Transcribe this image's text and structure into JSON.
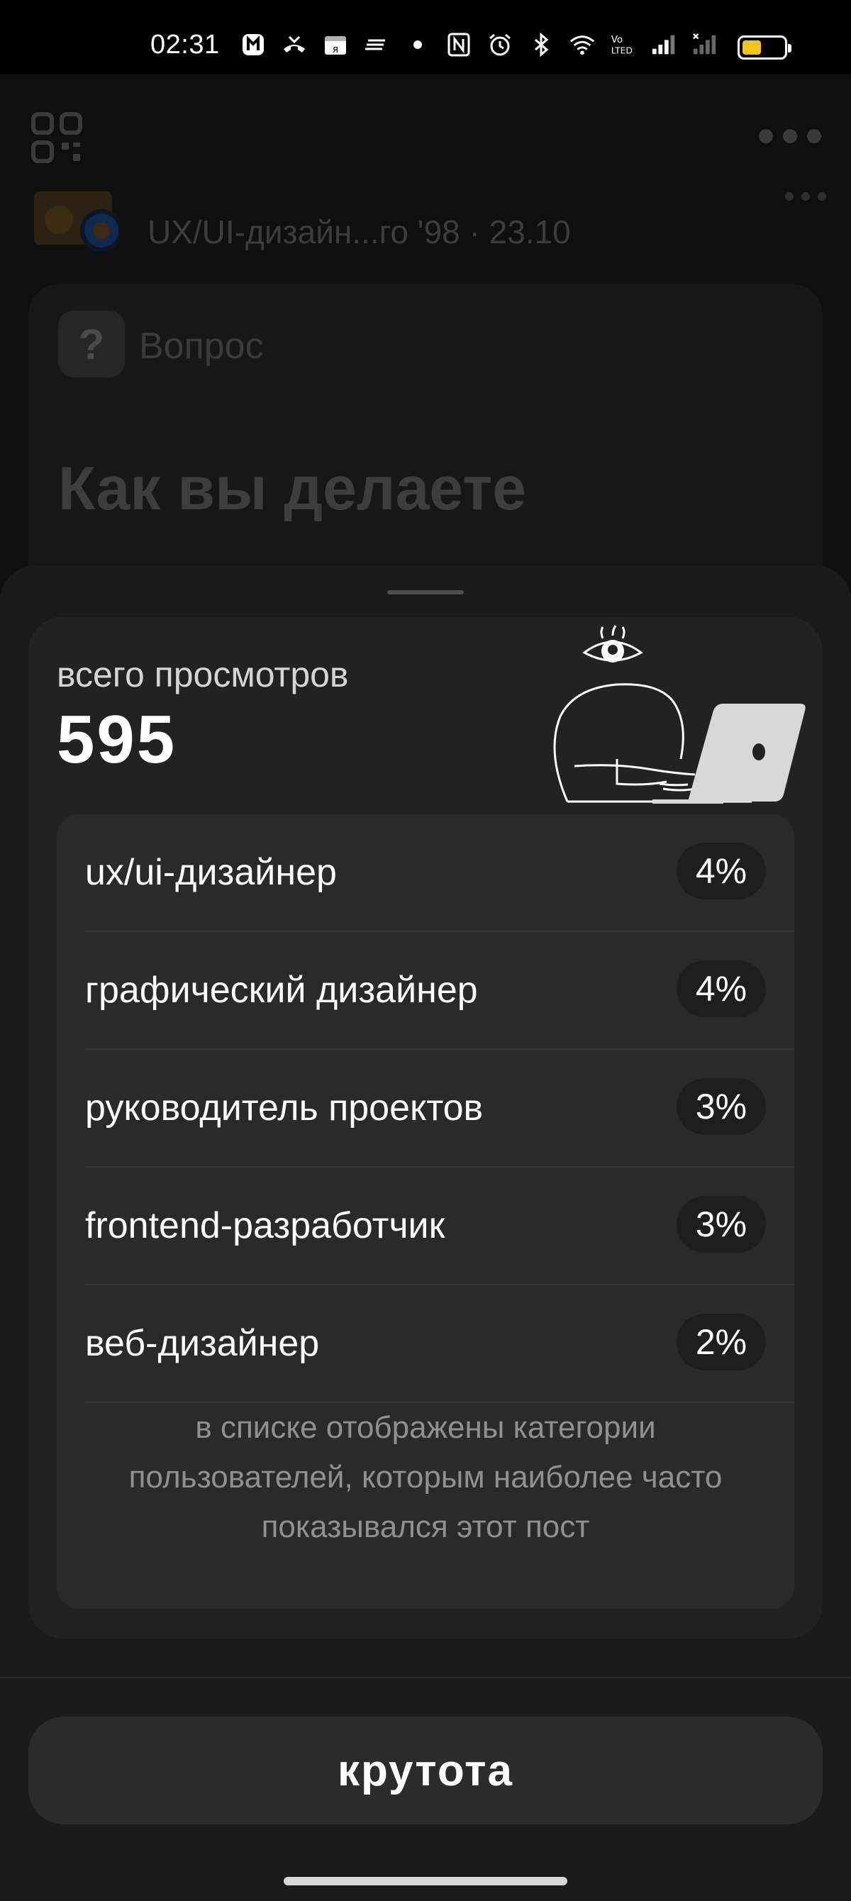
{
  "status_bar": {
    "time": "02:31",
    "icons": [
      "app-icon",
      "missed-call-icon",
      "yandex-icon",
      "notes-icon",
      "dot-icon",
      "nfc-icon",
      "alarm-icon",
      "bluetooth-icon",
      "wifi-icon",
      "volte-icon",
      "signal-icon",
      "signal-empty-icon",
      "battery-icon"
    ],
    "volte_text": "Vo\nLTED",
    "battery_level": 0.45,
    "battery_color": "#f5c41b"
  },
  "background_post": {
    "author_meta": "UX/UI-дизайн...го '98 · 23.10",
    "question_badge": "?",
    "question_label": "Вопрос",
    "title": "Как вы делаете"
  },
  "sheet": {
    "views_label": "всего просмотров",
    "views_count": "595",
    "categories": [
      {
        "label": "ux/ui-дизайнер",
        "percent": "4%"
      },
      {
        "label": "графический дизайнер",
        "percent": "4%"
      },
      {
        "label": "руководитель проектов",
        "percent": "3%"
      },
      {
        "label": "frontend-разработчик",
        "percent": "3%"
      },
      {
        "label": "веб-дизайнер",
        "percent": "2%"
      }
    ],
    "note": "в списке отображены категории пользователей, которым наиболее часто показывался этот пост",
    "button_label": "крутота"
  },
  "colors": {
    "sheet_bg": "#1a1a1a",
    "card_bg": "#222222",
    "list_bg": "#2a2a2a",
    "accent_text": "#ffffff"
  }
}
